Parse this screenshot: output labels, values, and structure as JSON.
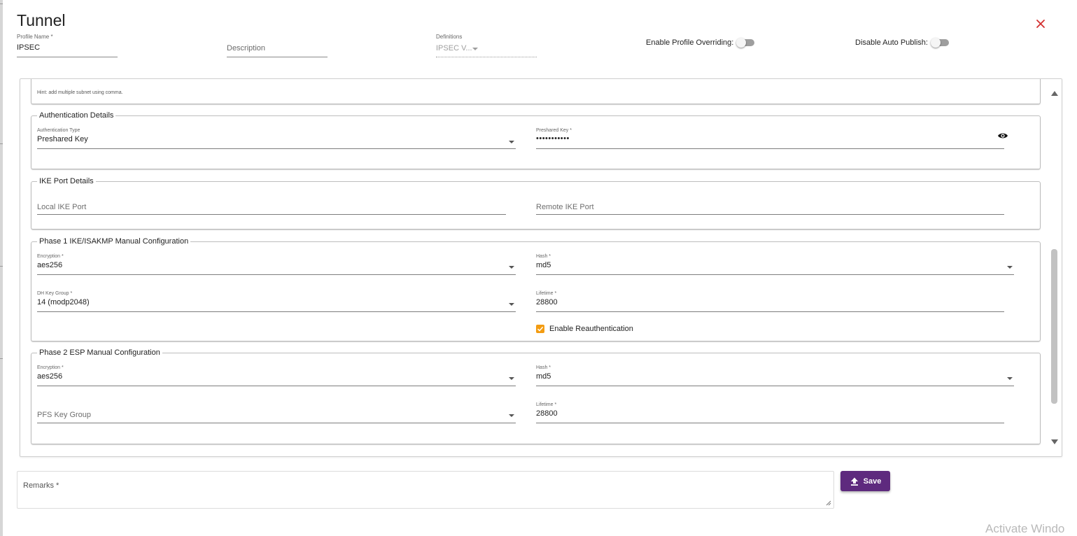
{
  "dialog": {
    "title": "Tunnel",
    "header": {
      "profile_name": {
        "label": "Profile Name *",
        "value": "IPSEC"
      },
      "description": {
        "placeholder": "Description"
      },
      "definitions": {
        "label": "Definitions",
        "value": "IPSEC V..."
      },
      "enable_profile_overriding": {
        "label": "Enable Profile Overriding:",
        "on": false
      },
      "disable_auto_publish": {
        "label": "Disable Auto Publish:",
        "on": false
      }
    },
    "hint": "Hint: add multiple subnet using comma.",
    "authentication": {
      "legend": "Authentication Details",
      "type": {
        "label": "Authentication Type",
        "value": "Preshared Key"
      },
      "preshared_key": {
        "label": "Preshared Key *",
        "value": "•••••••••••"
      }
    },
    "ike_port": {
      "legend": "IKE Port Details",
      "local": {
        "placeholder": "Local IKE Port"
      },
      "remote": {
        "placeholder": "Remote IKE Port"
      }
    },
    "phase1": {
      "legend": "Phase 1 IKE/ISAKMP Manual Configuration",
      "encryption": {
        "label": "Encryption *",
        "value": "aes256"
      },
      "hash": {
        "label": "Hash *",
        "value": "md5"
      },
      "dh_key_group": {
        "label": "DH Key Group *",
        "value": "14 (modp2048)"
      },
      "lifetime": {
        "label": "Lifetime *",
        "value": "28800"
      },
      "reauth": {
        "label": "Enable Reauthentication",
        "checked": true
      }
    },
    "phase2": {
      "legend": "Phase 2 ESP Manual Configuration",
      "encryption": {
        "label": "Encryption *",
        "value": "aes256"
      },
      "hash": {
        "label": "Hash *",
        "value": "md5"
      },
      "pfs_key_group": {
        "placeholder": "PFS Key Group"
      },
      "lifetime": {
        "label": "Lifetime *",
        "value": "28800"
      }
    },
    "remarks": {
      "label": "Remarks *"
    },
    "save": {
      "label": "Save"
    }
  },
  "watermark": "Activate Windo",
  "colors": {
    "accent": "#5e2a7e",
    "close": "#d32f2f",
    "checkbox": "#f39c12"
  },
  "icons": [
    "close-icon",
    "eye-icon",
    "upload-icon",
    "chevron-down-icon",
    "check-icon",
    "resize-grip-icon"
  ]
}
